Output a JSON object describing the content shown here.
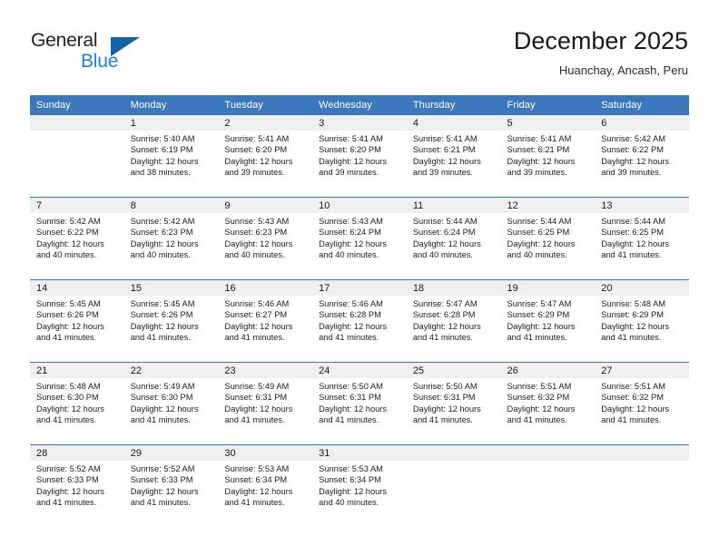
{
  "logo": {
    "word1": "General",
    "word2": "Blue",
    "triangle_color": "#1464a5",
    "blue_color": "#1c7fd4"
  },
  "header": {
    "title": "December 2025",
    "subtitle": "Huanchay, Ancash, Peru"
  },
  "theme": {
    "header_bg": "#3a77bb",
    "header_text": "#ffffff",
    "daynum_bg": "#efefef",
    "cell_bg": "#ffffff",
    "grid_line": "#3a77bb"
  },
  "weekday_headers": [
    "Sunday",
    "Monday",
    "Tuesday",
    "Wednesday",
    "Thursday",
    "Friday",
    "Saturday"
  ],
  "weeks": [
    [
      {
        "day": "",
        "lines": []
      },
      {
        "day": "1",
        "lines": [
          "Sunrise: 5:40 AM",
          "Sunset: 6:19 PM",
          "Daylight: 12 hours",
          "and 38 minutes."
        ]
      },
      {
        "day": "2",
        "lines": [
          "Sunrise: 5:41 AM",
          "Sunset: 6:20 PM",
          "Daylight: 12 hours",
          "and 39 minutes."
        ]
      },
      {
        "day": "3",
        "lines": [
          "Sunrise: 5:41 AM",
          "Sunset: 6:20 PM",
          "Daylight: 12 hours",
          "and 39 minutes."
        ]
      },
      {
        "day": "4",
        "lines": [
          "Sunrise: 5:41 AM",
          "Sunset: 6:21 PM",
          "Daylight: 12 hours",
          "and 39 minutes."
        ]
      },
      {
        "day": "5",
        "lines": [
          "Sunrise: 5:41 AM",
          "Sunset: 6:21 PM",
          "Daylight: 12 hours",
          "and 39 minutes."
        ]
      },
      {
        "day": "6",
        "lines": [
          "Sunrise: 5:42 AM",
          "Sunset: 6:22 PM",
          "Daylight: 12 hours",
          "and 39 minutes."
        ]
      }
    ],
    [
      {
        "day": "7",
        "lines": [
          "Sunrise: 5:42 AM",
          "Sunset: 6:22 PM",
          "Daylight: 12 hours",
          "and 40 minutes."
        ]
      },
      {
        "day": "8",
        "lines": [
          "Sunrise: 5:42 AM",
          "Sunset: 6:23 PM",
          "Daylight: 12 hours",
          "and 40 minutes."
        ]
      },
      {
        "day": "9",
        "lines": [
          "Sunrise: 5:43 AM",
          "Sunset: 6:23 PM",
          "Daylight: 12 hours",
          "and 40 minutes."
        ]
      },
      {
        "day": "10",
        "lines": [
          "Sunrise: 5:43 AM",
          "Sunset: 6:24 PM",
          "Daylight: 12 hours",
          "and 40 minutes."
        ]
      },
      {
        "day": "11",
        "lines": [
          "Sunrise: 5:44 AM",
          "Sunset: 6:24 PM",
          "Daylight: 12 hours",
          "and 40 minutes."
        ]
      },
      {
        "day": "12",
        "lines": [
          "Sunrise: 5:44 AM",
          "Sunset: 6:25 PM",
          "Daylight: 12 hours",
          "and 40 minutes."
        ]
      },
      {
        "day": "13",
        "lines": [
          "Sunrise: 5:44 AM",
          "Sunset: 6:25 PM",
          "Daylight: 12 hours",
          "and 41 minutes."
        ]
      }
    ],
    [
      {
        "day": "14",
        "lines": [
          "Sunrise: 5:45 AM",
          "Sunset: 6:26 PM",
          "Daylight: 12 hours",
          "and 41 minutes."
        ]
      },
      {
        "day": "15",
        "lines": [
          "Sunrise: 5:45 AM",
          "Sunset: 6:26 PM",
          "Daylight: 12 hours",
          "and 41 minutes."
        ]
      },
      {
        "day": "16",
        "lines": [
          "Sunrise: 5:46 AM",
          "Sunset: 6:27 PM",
          "Daylight: 12 hours",
          "and 41 minutes."
        ]
      },
      {
        "day": "17",
        "lines": [
          "Sunrise: 5:46 AM",
          "Sunset: 6:28 PM",
          "Daylight: 12 hours",
          "and 41 minutes."
        ]
      },
      {
        "day": "18",
        "lines": [
          "Sunrise: 5:47 AM",
          "Sunset: 6:28 PM",
          "Daylight: 12 hours",
          "and 41 minutes."
        ]
      },
      {
        "day": "19",
        "lines": [
          "Sunrise: 5:47 AM",
          "Sunset: 6:29 PM",
          "Daylight: 12 hours",
          "and 41 minutes."
        ]
      },
      {
        "day": "20",
        "lines": [
          "Sunrise: 5:48 AM",
          "Sunset: 6:29 PM",
          "Daylight: 12 hours",
          "and 41 minutes."
        ]
      }
    ],
    [
      {
        "day": "21",
        "lines": [
          "Sunrise: 5:48 AM",
          "Sunset: 6:30 PM",
          "Daylight: 12 hours",
          "and 41 minutes."
        ]
      },
      {
        "day": "22",
        "lines": [
          "Sunrise: 5:49 AM",
          "Sunset: 6:30 PM",
          "Daylight: 12 hours",
          "and 41 minutes."
        ]
      },
      {
        "day": "23",
        "lines": [
          "Sunrise: 5:49 AM",
          "Sunset: 6:31 PM",
          "Daylight: 12 hours",
          "and 41 minutes."
        ]
      },
      {
        "day": "24",
        "lines": [
          "Sunrise: 5:50 AM",
          "Sunset: 6:31 PM",
          "Daylight: 12 hours",
          "and 41 minutes."
        ]
      },
      {
        "day": "25",
        "lines": [
          "Sunrise: 5:50 AM",
          "Sunset: 6:31 PM",
          "Daylight: 12 hours",
          "and 41 minutes."
        ]
      },
      {
        "day": "26",
        "lines": [
          "Sunrise: 5:51 AM",
          "Sunset: 6:32 PM",
          "Daylight: 12 hours",
          "and 41 minutes."
        ]
      },
      {
        "day": "27",
        "lines": [
          "Sunrise: 5:51 AM",
          "Sunset: 6:32 PM",
          "Daylight: 12 hours",
          "and 41 minutes."
        ]
      }
    ],
    [
      {
        "day": "28",
        "lines": [
          "Sunrise: 5:52 AM",
          "Sunset: 6:33 PM",
          "Daylight: 12 hours",
          "and 41 minutes."
        ]
      },
      {
        "day": "29",
        "lines": [
          "Sunrise: 5:52 AM",
          "Sunset: 6:33 PM",
          "Daylight: 12 hours",
          "and 41 minutes."
        ]
      },
      {
        "day": "30",
        "lines": [
          "Sunrise: 5:53 AM",
          "Sunset: 6:34 PM",
          "Daylight: 12 hours",
          "and 41 minutes."
        ]
      },
      {
        "day": "31",
        "lines": [
          "Sunrise: 5:53 AM",
          "Sunset: 6:34 PM",
          "Daylight: 12 hours",
          "and 40 minutes."
        ]
      },
      {
        "day": "",
        "lines": []
      },
      {
        "day": "",
        "lines": []
      },
      {
        "day": "",
        "lines": []
      }
    ]
  ]
}
